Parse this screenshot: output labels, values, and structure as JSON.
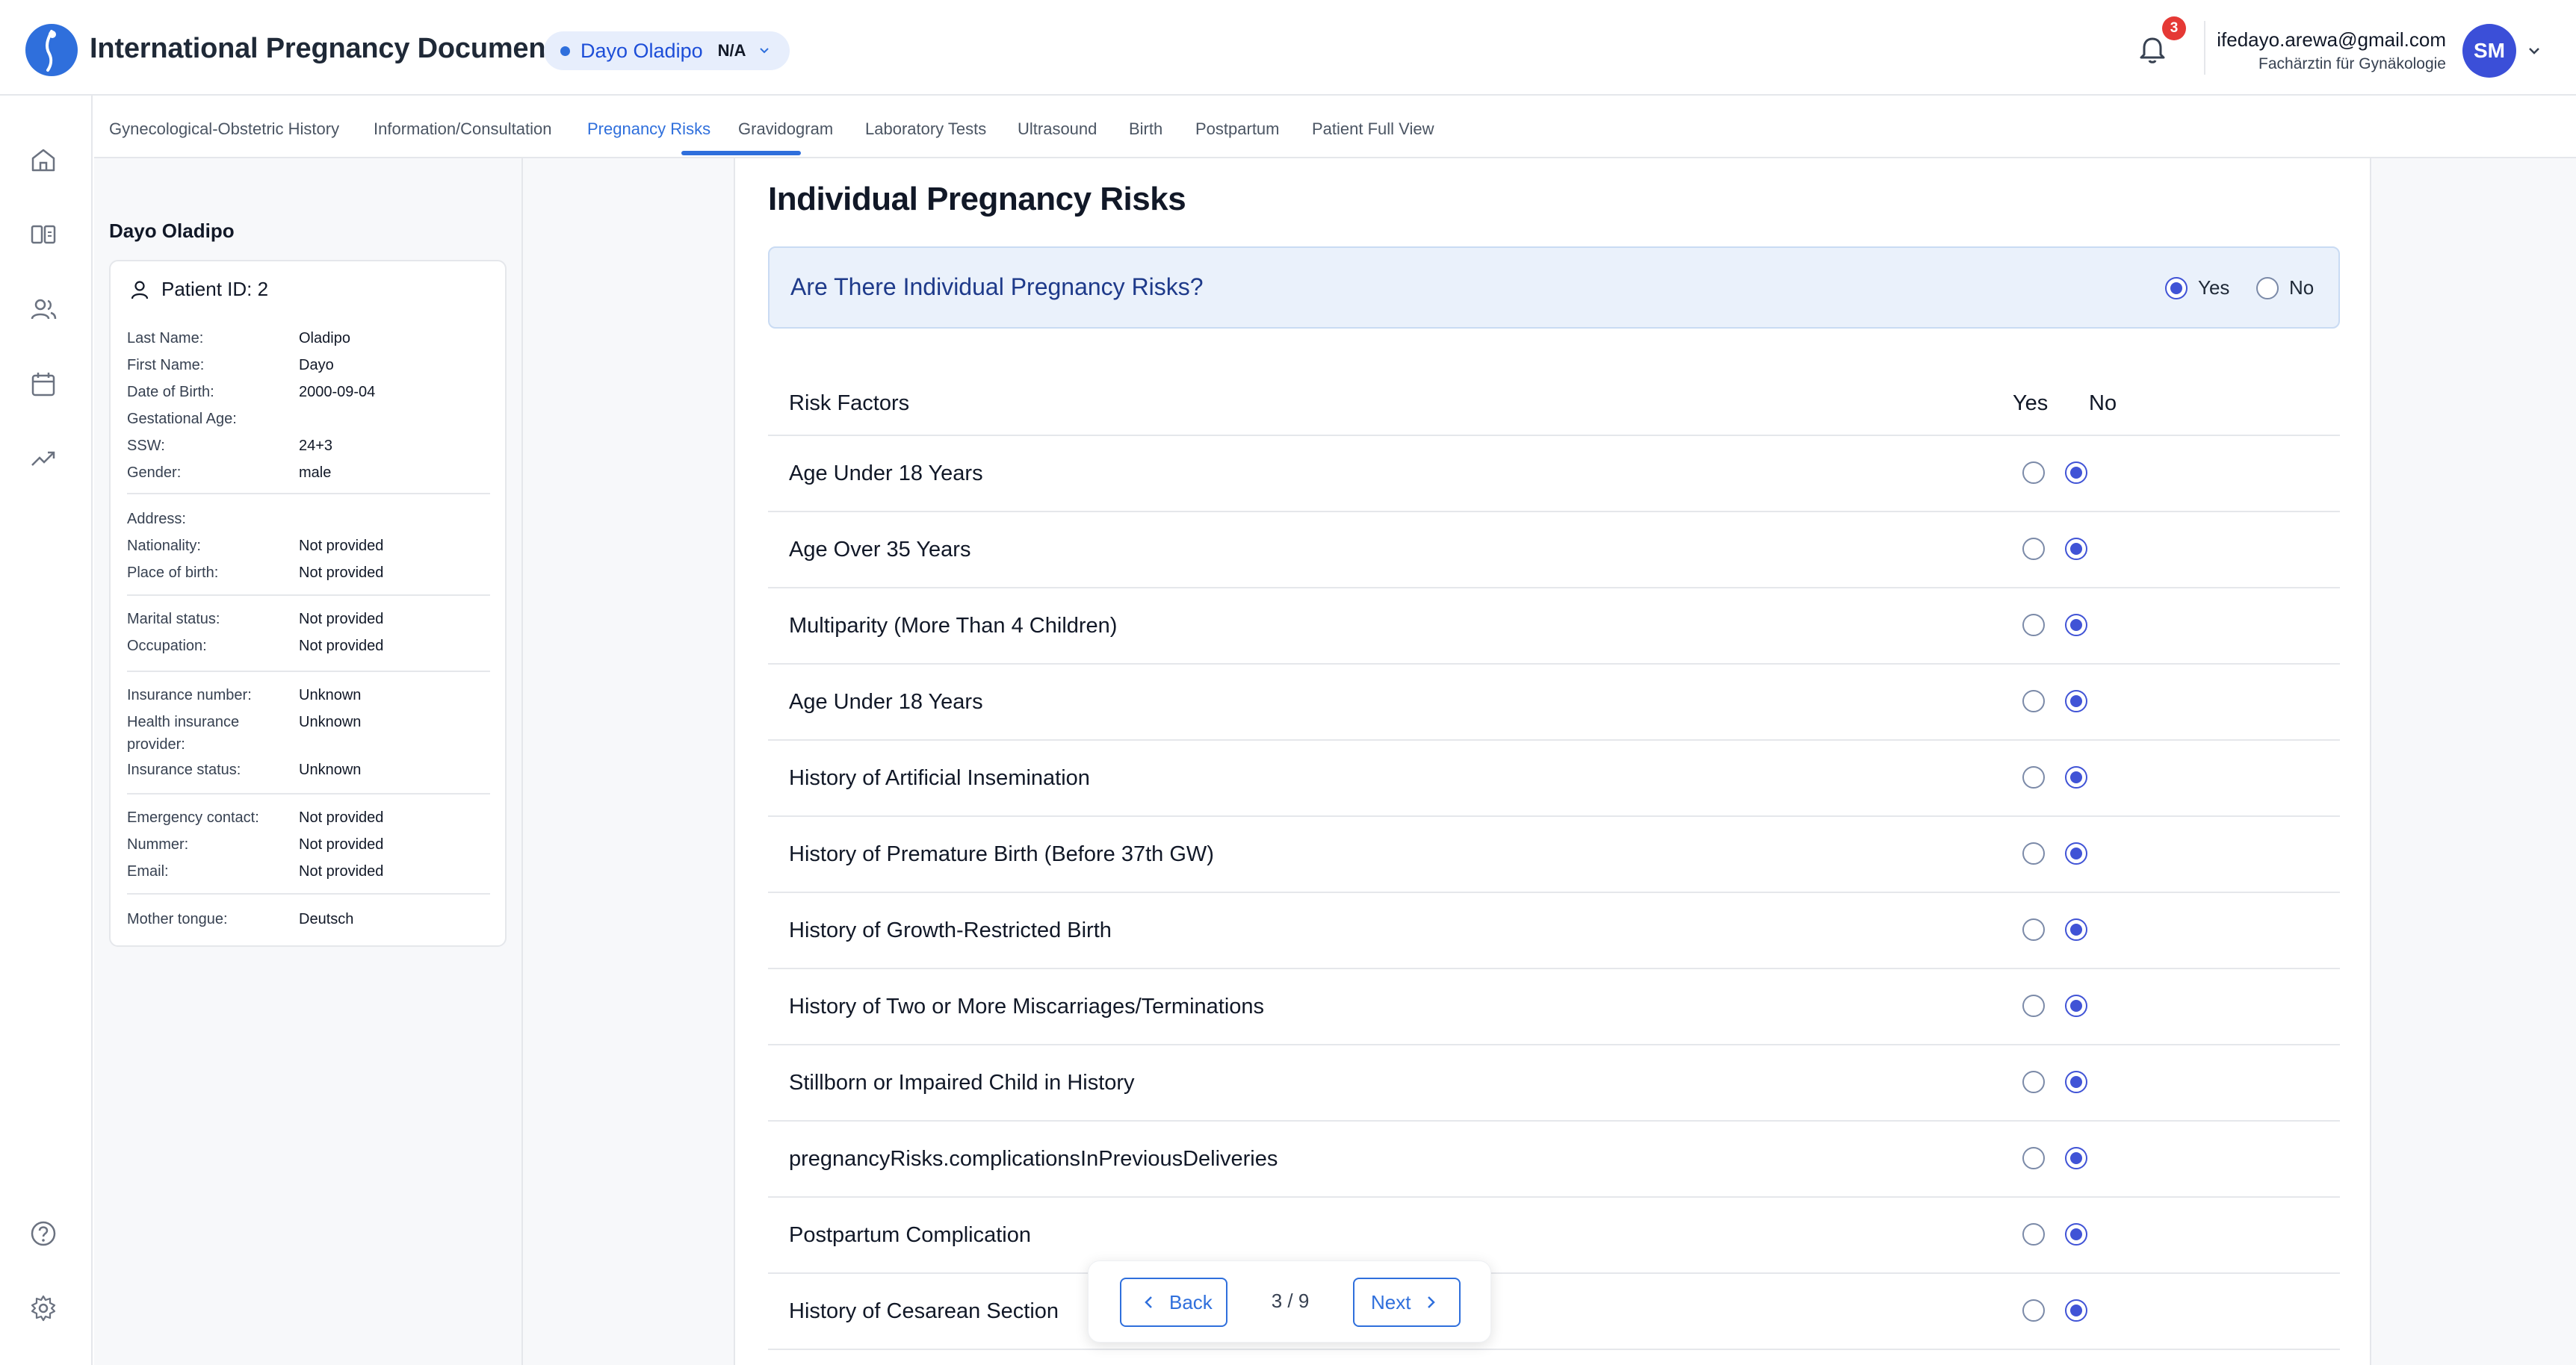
{
  "header": {
    "app_title": "International Pregnancy Document",
    "patient_pill": {
      "name": "Dayo Oladipo",
      "status": "N/A"
    },
    "notifications_count": "3",
    "user": {
      "email": "ifedayo.arewa@gmail.com",
      "role": "Fachärztin für Gynäkologie",
      "initials": "SM"
    },
    "icons": [
      "logo-icon",
      "bell-icon",
      "chevron-down-icon"
    ]
  },
  "rail": {
    "items": [
      "home-icon",
      "book-icon",
      "users-icon",
      "calendar-icon",
      "trend-icon"
    ],
    "bottom_items": [
      "help-icon",
      "gear-icon"
    ]
  },
  "tabs": [
    {
      "label": "Gynecological-Obstetric History"
    },
    {
      "label": "Information/Consultation"
    },
    {
      "label": "Pregnancy Risks",
      "active": true
    },
    {
      "label": "Gravidogram"
    },
    {
      "label": "Laboratory Tests"
    },
    {
      "label": "Ultrasound"
    },
    {
      "label": "Birth"
    },
    {
      "label": "Postpartum"
    },
    {
      "label": "Patient Full View"
    }
  ],
  "patient": {
    "heading": "Dayo Oladipo",
    "id_label": "Patient ID: 2",
    "fields": [
      {
        "label": "Last Name:",
        "value": "Oladipo"
      },
      {
        "label": "First Name:",
        "value": "Dayo"
      },
      {
        "label": "Date of Birth:",
        "value": "2000-09-04"
      },
      {
        "label": "Gestational Age:",
        "value": ""
      },
      {
        "label": "SSW:",
        "value": "24+3"
      },
      {
        "label": "Gender:",
        "value": "male"
      },
      {
        "label": "Address:",
        "value": ""
      },
      {
        "label": "Nationality:",
        "value": "Not provided"
      },
      {
        "label": "Place of birth:",
        "value": "Not provided"
      },
      {
        "label": "Marital status:",
        "value": "Not provided"
      },
      {
        "label": "Occupation:",
        "value": "Not provided"
      },
      {
        "label": "Insurance number:",
        "value": "Unknown"
      },
      {
        "label": "Health insurance",
        "value": "Unknown"
      },
      {
        "label": "provider:",
        "value": ""
      },
      {
        "label": "Insurance status:",
        "value": "Unknown"
      },
      {
        "label": "Emergency contact:",
        "value": "Not provided"
      },
      {
        "label": "Nummer:",
        "value": "Not provided"
      },
      {
        "label": "Email:",
        "value": "Not provided"
      },
      {
        "label": "Mother tongue:",
        "value": "Deutsch"
      }
    ]
  },
  "main": {
    "title": "Individual Pregnancy Risks",
    "question": {
      "text": "Are There Individual Pregnancy Risks?",
      "yes_label": "Yes",
      "no_label": "No",
      "selected": "yes"
    },
    "table_headers": {
      "label": "Risk Factors",
      "yes": "Yes",
      "no": "No"
    },
    "risks": [
      {
        "label": "Age Under 18 Years",
        "selected": "no"
      },
      {
        "label": "Age Over 35 Years",
        "selected": "no"
      },
      {
        "label": "Multiparity (More Than 4 Children)",
        "selected": "no"
      },
      {
        "label": "Age Under 18 Years",
        "selected": "no"
      },
      {
        "label": "History of Artificial Insemination",
        "selected": "no"
      },
      {
        "label": "History of Premature Birth (Before 37th GW)",
        "selected": "no"
      },
      {
        "label": "History of Growth-Restricted Birth",
        "selected": "no"
      },
      {
        "label": "History of Two or More Miscarriages/Terminations",
        "selected": "no"
      },
      {
        "label": "Stillborn or Impaired Child in History",
        "selected": "no"
      },
      {
        "label": "pregnancyRisks.complicationsInPreviousDeliveries",
        "selected": "no"
      },
      {
        "label": "Postpartum Complication",
        "selected": "no"
      },
      {
        "label": "History of Cesarean Section",
        "selected": "no"
      }
    ]
  },
  "pager": {
    "back_label": "Back",
    "next_label": "Next",
    "current": "3 / 9"
  },
  "colors": {
    "accent": "#2f6fdc",
    "radio_selected": "#4053d6",
    "question_bg": "#eaf1fb",
    "badge": "#e53935"
  }
}
